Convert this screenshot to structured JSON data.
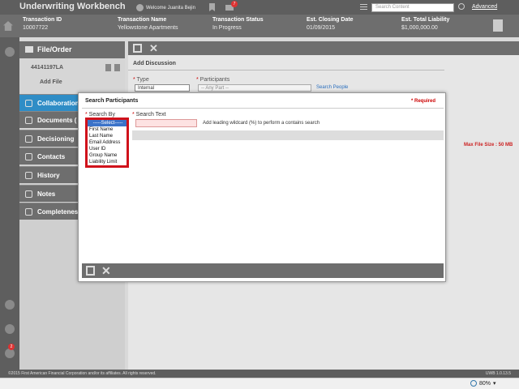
{
  "app": {
    "title": "Underwriting Workbench",
    "welcome": "Welcome Juanita Bejin",
    "mail_count": "7",
    "search_placeholder": "Search Content",
    "advanced_link": "Advanced"
  },
  "info": {
    "columns": [
      {
        "label": "Transaction ID",
        "value": "10007722"
      },
      {
        "label": "Transaction Name",
        "value": "Yellowstone Apartments"
      },
      {
        "label": "Transaction Status",
        "value": "In Progress"
      },
      {
        "label": "Est. Closing Date",
        "value": "01/09/2015"
      },
      {
        "label": "Est. Total Liability",
        "value": "$1,000,000.00"
      }
    ]
  },
  "sidenav": {
    "file_order": "File/Order",
    "file_number": "44141197LA",
    "add_file": "Add File",
    "items": [
      {
        "label": "Collaboration",
        "active": true
      },
      {
        "label": "Documents (",
        "active": false
      },
      {
        "label": "Decisioning",
        "active": false
      },
      {
        "label": "Contacts",
        "active": false
      },
      {
        "label": "History",
        "active": false
      },
      {
        "label": "Notes",
        "active": false
      },
      {
        "label": "Completeness",
        "active": false
      }
    ],
    "rail_badge": "2"
  },
  "main": {
    "title": "Add Discussion",
    "type_label": "Type",
    "type_value": "Internal",
    "participants_label": "Participants",
    "participants_value": "-- Any Part --",
    "search_people": "Search People",
    "max_file_size": "Max File Size : 50 MB"
  },
  "modal": {
    "title": "Search Participants",
    "required": "* Required",
    "search_by_label": "Search By",
    "search_text_label": "Search Text",
    "hint": "Add leading wildcard (%) to perform a contains search",
    "dropdown_options": [
      "-----Select-----",
      "First Name",
      "Last Name",
      "Email Address",
      "User ID",
      "Group Name",
      "Liability Limit"
    ]
  },
  "footer": {
    "copyright": "©2015 First American Financial Corporation and/or its affiliates. All rights reserved.",
    "version": "UWB 1.0.13.5"
  },
  "statusbar": {
    "zoom": "80%"
  }
}
